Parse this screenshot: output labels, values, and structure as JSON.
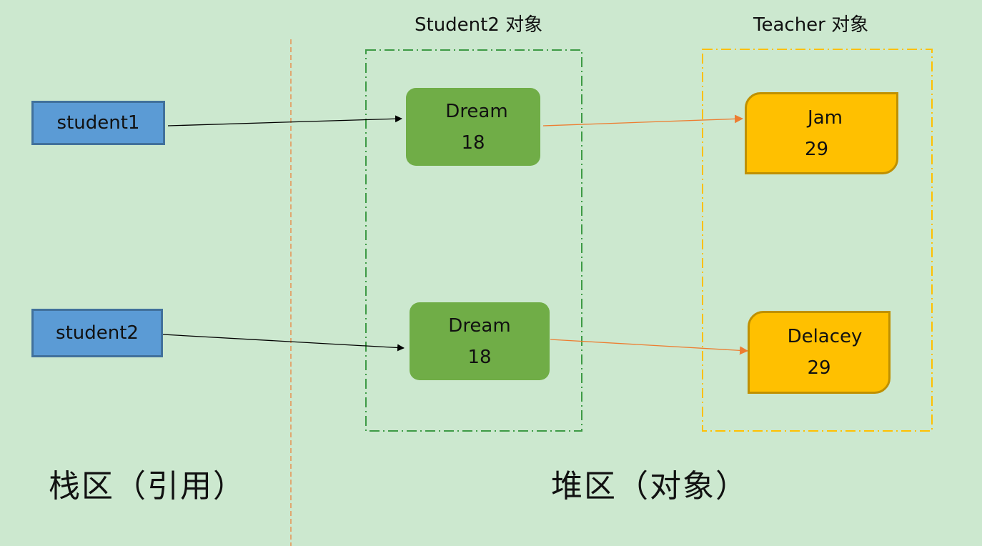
{
  "colors": {
    "background": "#cce8cf",
    "reference_fill": "#5b9bd5",
    "reference_border": "#41719c",
    "student_fill": "#70ad47",
    "student_group_border": "#3d9a45",
    "teacher_fill": "#ffc000",
    "teacher_border": "#bf9000",
    "teacher_group_border": "#ffc000",
    "divider": "#ed7d31",
    "reference_arrow": "#000000",
    "object_arrow": "#ed7d31"
  },
  "groups": {
    "student2": {
      "label": "Student2 对象"
    },
    "teacher": {
      "label": "Teacher 对象"
    }
  },
  "references": [
    {
      "label": "student1"
    },
    {
      "label": "student2"
    }
  ],
  "students": [
    {
      "name": "Dream",
      "age": "18"
    },
    {
      "name": "Dream",
      "age": "18"
    }
  ],
  "teachers": [
    {
      "name": "Jam",
      "age": "29"
    },
    {
      "name": "Delacey",
      "age": "29"
    }
  ],
  "regions": {
    "stack": "栈区（引用）",
    "heap": "堆区（对象）"
  },
  "links": [
    {
      "from": "student1",
      "to": "students.0",
      "kind": "reference"
    },
    {
      "from": "student2",
      "to": "students.1",
      "kind": "reference"
    },
    {
      "from": "students.0",
      "to": "teachers.0",
      "kind": "object"
    },
    {
      "from": "students.1",
      "to": "teachers.1",
      "kind": "object"
    }
  ]
}
